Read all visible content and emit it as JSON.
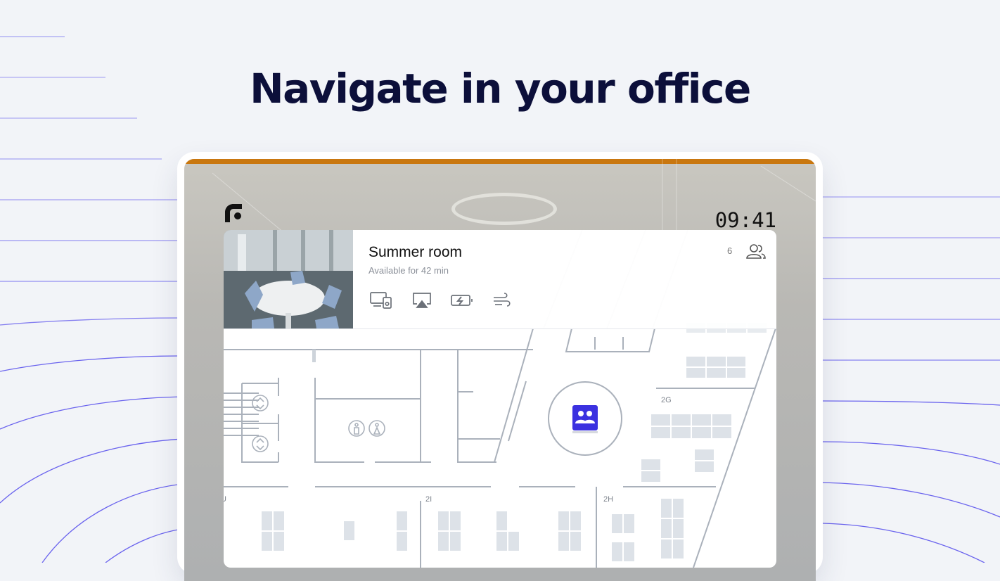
{
  "page": {
    "headline": "Navigate in your office"
  },
  "device": {
    "clock": "09:41",
    "accent_color": "#c9770f",
    "logo_icon": "brand-f-logo-icon"
  },
  "room": {
    "name": "Summer room",
    "status": "Available for 42 min",
    "capacity": "6",
    "capacity_icon": "people-icon",
    "amenities": [
      "display-with-speaker-icon",
      "airplay-icon",
      "charging-icon",
      "air-conditioning-icon"
    ]
  },
  "map": {
    "zones": [
      "2G",
      "2I",
      "2H",
      "U"
    ],
    "marker_icon": "meeting-room-icon",
    "marker_color": "#3b31e0",
    "facility_icons": [
      "elevator-icon",
      "elevator-icon",
      "restroom-male-icon",
      "restroom-female-icon"
    ]
  },
  "colors": {
    "background": "#f2f4f8",
    "headline": "#0c0f3a",
    "lines": "#5b54e8"
  }
}
